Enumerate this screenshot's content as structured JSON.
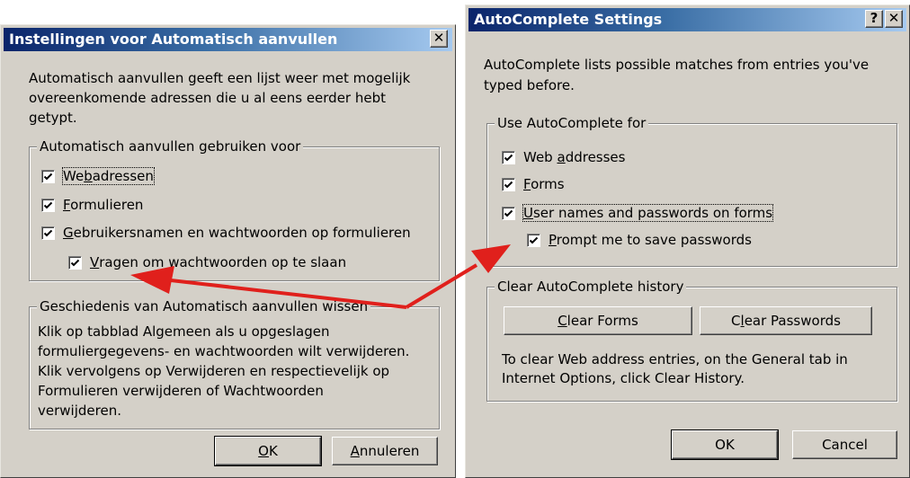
{
  "dutch": {
    "title": "Instellingen voor Automatisch aanvullen",
    "close_glyph": "✕",
    "intro": [
      "Automatisch aanvullen geeft een lijst weer met mogelijk",
      "overeenkomende adressen die u al eens eerder hebt",
      "getypt."
    ],
    "use_group": {
      "legend": "Automatisch aanvullen gebruiken voor",
      "items": [
        {
          "pre": "We",
          "u": "b",
          "post": "adressen",
          "checked": true
        },
        {
          "pre": "",
          "u": "F",
          "post": "ormulieren",
          "checked": true
        },
        {
          "pre": "",
          "u": "G",
          "post": "ebruikersnamen en wachtwoorden op formulieren",
          "checked": true
        },
        {
          "pre": "",
          "u": "V",
          "post": "ragen om wachtwoorden op te slaan",
          "checked": true
        }
      ]
    },
    "history_group": {
      "legend": "Geschiedenis van Automatisch aanvullen wissen",
      "lines": [
        "Klik op tabblad Algemeen als u opgeslagen",
        "formuliergegevens- en wachtwoorden wilt verwijderen.",
        "Klik vervolgens op Verwijderen en respectievelijk op",
        "Formulieren verwijderen of Wachtwoorden",
        "verwijderen."
      ]
    },
    "ok": {
      "pre": "",
      "u": "O",
      "post": "K"
    },
    "cancel": {
      "pre": "",
      "u": "A",
      "post": "nnuleren"
    }
  },
  "english": {
    "title": "AutoComplete Settings",
    "help_glyph": "?",
    "close_glyph": "✕",
    "intro": [
      "AutoComplete lists possible matches from entries you've",
      "typed before."
    ],
    "use_group": {
      "legend": "Use AutoComplete for",
      "items": [
        {
          "pre": "Web ",
          "u": "a",
          "post": "ddresses",
          "checked": true
        },
        {
          "pre": "",
          "u": "F",
          "post": "orms",
          "checked": true
        },
        {
          "pre": "",
          "u": "U",
          "post": "ser names and passwords on forms",
          "checked": true
        },
        {
          "pre": "",
          "u": "P",
          "post": "rompt me to save passwords",
          "checked": true
        }
      ]
    },
    "history_group": {
      "legend": "Clear AutoComplete history",
      "clear_forms": {
        "pre": "",
        "u": "C",
        "post": "lear Forms"
      },
      "clear_passwords": {
        "pre": "C",
        "u": "l",
        "post": "ear Passwords"
      },
      "lines": [
        "To clear Web address entries, on the General tab in",
        "Internet Options, click Clear History."
      ]
    },
    "ok": "OK",
    "cancel": "Cancel"
  },
  "colors": {
    "arrow": "#e0201c",
    "dialog_bg": "#d4d0c8",
    "title_start": "#0a246a"
  }
}
